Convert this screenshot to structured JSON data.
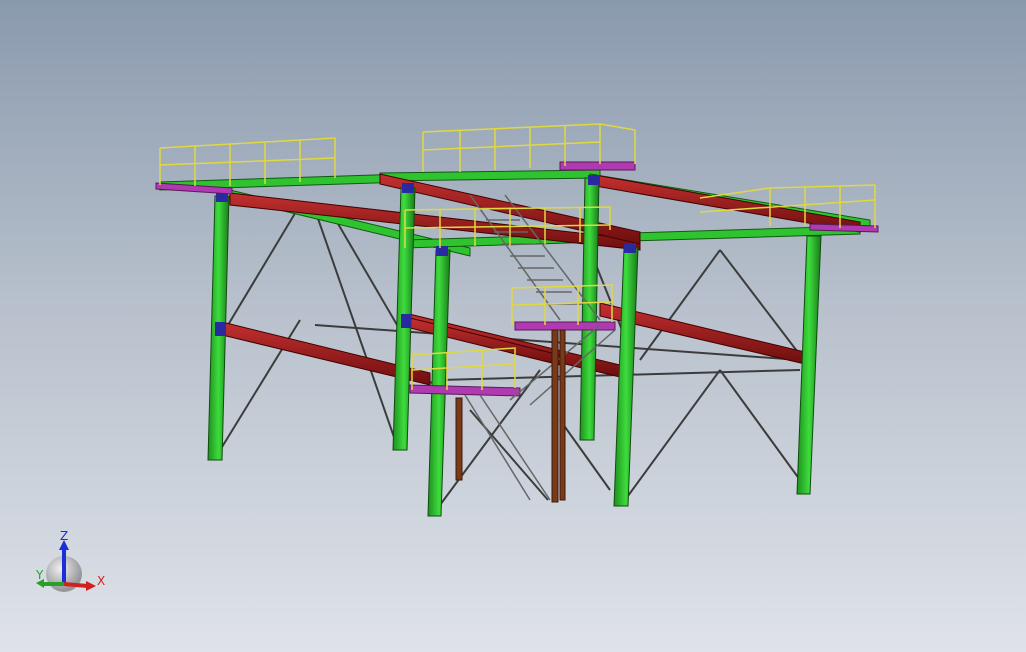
{
  "viewport": {
    "background_top": "#8a9aae",
    "background_bottom": "#dfe3e9"
  },
  "model": {
    "colors": {
      "column": "#2fc42f",
      "girder": "#a01818",
      "brace": "#3c3c3c",
      "handrail": "#e8e04a",
      "deck_trim": "#b03ab0",
      "stair": "#777777",
      "support_leg": "#7a3a1a"
    }
  },
  "triad": {
    "z_label": "Z",
    "y_label": "Y",
    "x_label": "X",
    "z_color": "#1a2fd8",
    "y_color": "#2aa02a",
    "x_color": "#d02020"
  }
}
